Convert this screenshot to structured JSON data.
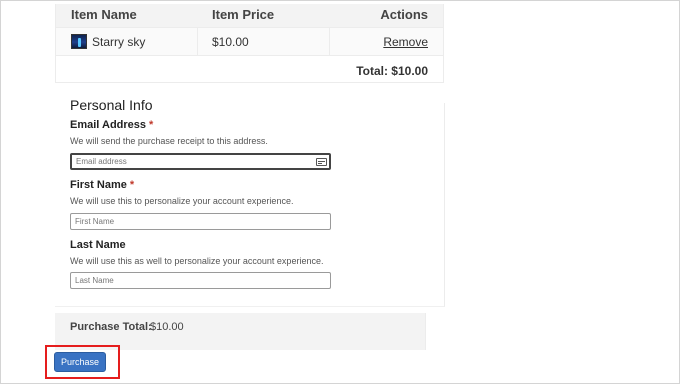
{
  "cart": {
    "headers": {
      "name": "Item Name",
      "price": "Item Price",
      "actions": "Actions"
    },
    "item": {
      "name": "Starry sky",
      "price": "$10.00",
      "action": "Remove",
      "thumbnail": "starry-sky-thumbnail"
    },
    "total": "Total: $10.00"
  },
  "personal_info": {
    "title": "Personal Info",
    "email": {
      "label": "Email Address",
      "required": "*",
      "help": "We will send the purchase receipt to this address.",
      "placeholder": "Email address"
    },
    "first_name": {
      "label": "First Name",
      "required": "*",
      "help": "We will use this to personalize your account experience.",
      "placeholder": "First Name"
    },
    "last_name": {
      "label": "Last Name",
      "help": "We will use this as well to personalize your account experience.",
      "placeholder": "Last Name"
    }
  },
  "purchase_total": {
    "label": "Purchase Total:",
    "value": "$10.00"
  },
  "purchase_button": "Purchase",
  "colors": {
    "button": "#3a73c3",
    "highlight": "#e51d1d",
    "required": "#c0392b"
  }
}
